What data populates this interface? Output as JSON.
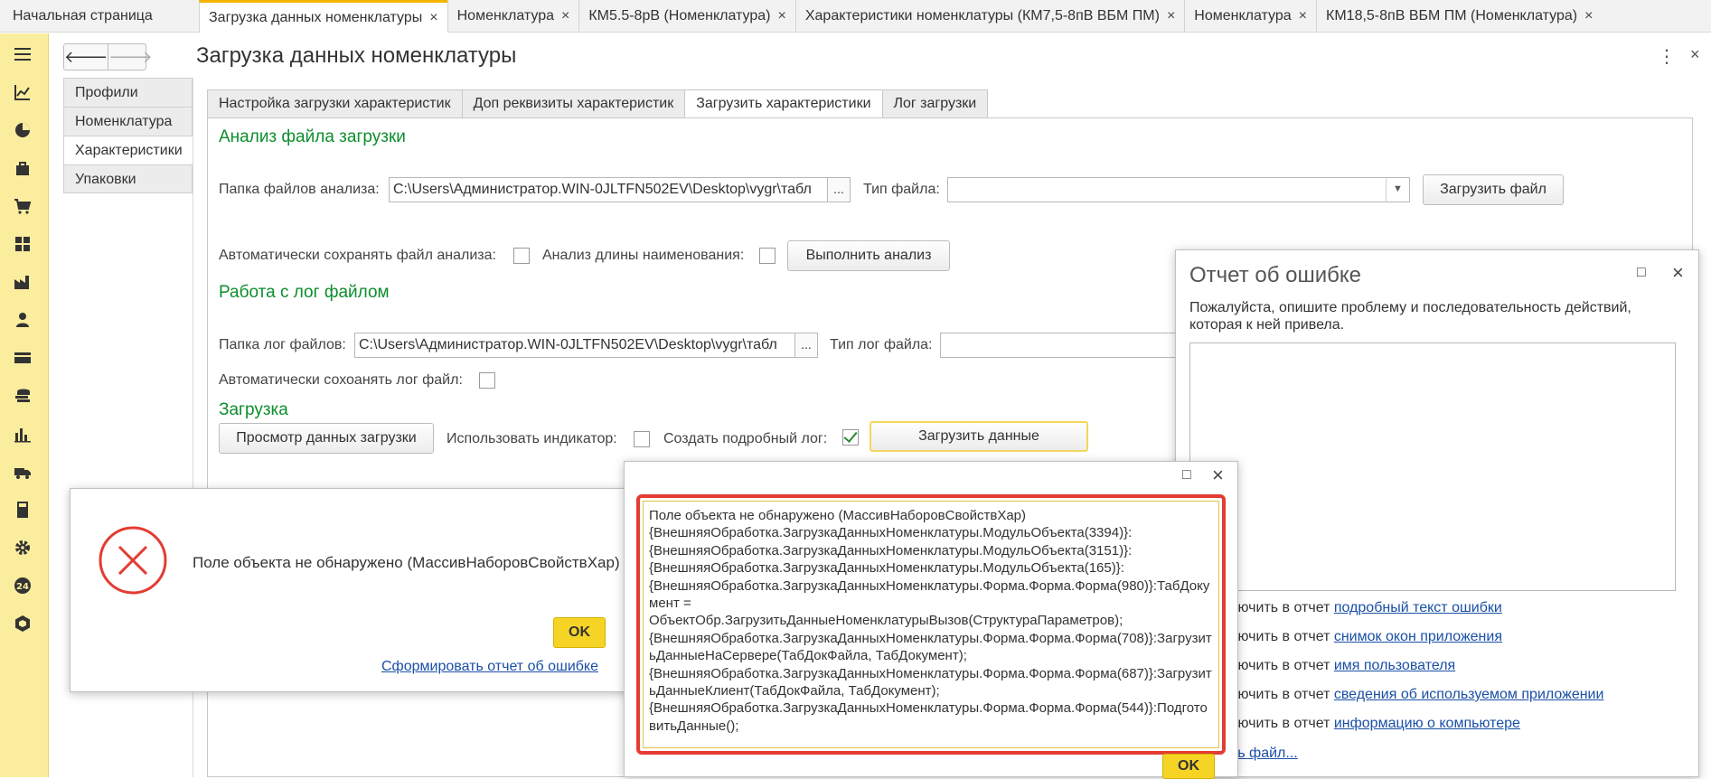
{
  "topbar": {
    "home_label": "Начальная страница",
    "tabs": [
      {
        "label": "Загрузка данных номенклатуры",
        "active": true
      },
      {
        "label": "Номенклатура",
        "active": false
      },
      {
        "label": "КМ5.5-8рВ (Номенклатура)",
        "active": false
      },
      {
        "label": "Характеристики номенклатуры (КМ7,5-8пВ ВБМ ПМ)",
        "active": false
      },
      {
        "label": "Номенклатура",
        "active": false
      },
      {
        "label": "КМ18,5-8пВ ВБМ ПМ (Номенклатура)",
        "active": false
      }
    ],
    "close_glyph": "×"
  },
  "sidebar": {
    "icons": [
      "menu-icon",
      "chart-trend-icon",
      "pie-chart-icon",
      "bag-icon",
      "cart-icon",
      "grid-icon",
      "factory-icon",
      "person-icon",
      "card-icon",
      "coins-icon",
      "bar-chart-icon",
      "truck-icon",
      "calculator-icon",
      "gear-icon",
      "24-icon",
      "cube-icon"
    ],
    "badge_24": "24"
  },
  "form": {
    "title": "Загрузка данных номенклатуры",
    "nav_back": "🡐",
    "nav_forward": "🡒",
    "more": "⋮",
    "close": "×",
    "left_items": [
      {
        "label": "Профили",
        "active": false
      },
      {
        "label": "Номенклатура",
        "active": false
      },
      {
        "label": "Характеристики",
        "active": true
      },
      {
        "label": "Упаковки",
        "active": false
      }
    ],
    "inner_tabs": [
      {
        "label": "Настройка загрузки характеристик",
        "active": false
      },
      {
        "label": "Доп реквизиты характеристик",
        "active": false
      },
      {
        "label": "Загрузить характеристики",
        "active": true
      },
      {
        "label": "Лог загрузки",
        "active": false
      }
    ],
    "analysis": {
      "title": "Анализ файла загрузки",
      "folder_label": "Папка файлов анализа:",
      "folder_value": "C:\\Users\\Администратор.WIN-0JLTFN502EV\\Desktop\\vygr\\табл",
      "dots": "...",
      "file_type_label": "Тип файла:",
      "file_type_value": "",
      "load_file_button": "Загрузить файл",
      "autosave_label": "Автоматически сохранять файл анализа:",
      "name_length_label": "Анализ длины наименования:",
      "run_button": "Выполнить анализ"
    },
    "log": {
      "title": "Работа с лог файлом",
      "folder_label": "Папка лог файлов:",
      "folder_value": "C:\\Users\\Администратор.WIN-0JLTFN502EV\\Desktop\\vygr\\табл",
      "dots": "...",
      "type_label": "Тип лог файла:",
      "autosave_label": "Автоматически сохоанять лог файл:"
    },
    "load": {
      "title": "Загрузка",
      "preview_button": "Просмотр данных загрузки",
      "indicator_label": "Использовать индикатор:",
      "detailed_log_label": "Создать подробный лог:",
      "detailed_log_checked": true,
      "load_button": "Загрузить данные"
    }
  },
  "error_dialog": {
    "message": "Поле объекта не обнаружено (МассивНаборовСвойствХар)",
    "ok": "OK",
    "report_link": "Сформировать отчет об ошибке"
  },
  "details_dialog": {
    "maximize": "□",
    "close": "×",
    "text": "Поле объекта не обнаружено (МассивНаборовСвойствХар)\n{ВнешняяОбработка.ЗагрузкаДанныхНоменклатуры.МодульОбъекта(3394)}:\n{ВнешняяОбработка.ЗагрузкаДанныхНоменклатуры.МодульОбъекта(3151)}:\n{ВнешняяОбработка.ЗагрузкаДанныхНоменклатуры.МодульОбъекта(165)}:\n{ВнешняяОбработка.ЗагрузкаДанныхНоменклатуры.Форма.Форма.Форма(980)}:ТабДокумент =\nОбъектОбр.ЗагрузитьДанныеНоменклатурыВызов(СтруктураПараметров);\n{ВнешняяОбработка.ЗагрузкаДанныхНоменклатуры.Форма.Форма.Форма(708)}:ЗагрузитьДанныеНаСервере(ТабДокФайла, ТабДокумент);\n{ВнешняяОбработка.ЗагрузкаДанныхНоменклатуры.Форма.Форма.Форма(687)}:ЗагрузитьДанныеКлиент(ТабДокФайла, ТабДокумент);\n{ВнешняяОбработка.ЗагрузкаДанныхНоменклатуры.Форма.Форма.Форма(544)}:ПодготовитьДанные();",
    "ok": "OK"
  },
  "report_dialog": {
    "title": "Отчет об ошибке",
    "maximize": "□",
    "close": "×",
    "description": "Пожалуйста, опишите проблему и последовательность действий, которая к ней привела.",
    "options": [
      {
        "prefix": "ключить в отчет ",
        "link": "подробный текст ошибки"
      },
      {
        "prefix": "ключить в отчет ",
        "link": "снимок окон приложения"
      },
      {
        "prefix": "ключить в отчет ",
        "link": "имя пользователя"
      },
      {
        "prefix": "ключить в отчет ",
        "link": "сведения об используемом приложении"
      },
      {
        "prefix": "ключить в отчет ",
        "link": "информацию о компьютере"
      }
    ],
    "attach_link": "ить файл..."
  },
  "colors": {
    "accent_yellow": "#f6d425",
    "sidebar_bg": "#fbed9e",
    "section_green": "#0c8e2c",
    "error_red": "#e33c33",
    "link_blue": "#1a4fa6"
  }
}
